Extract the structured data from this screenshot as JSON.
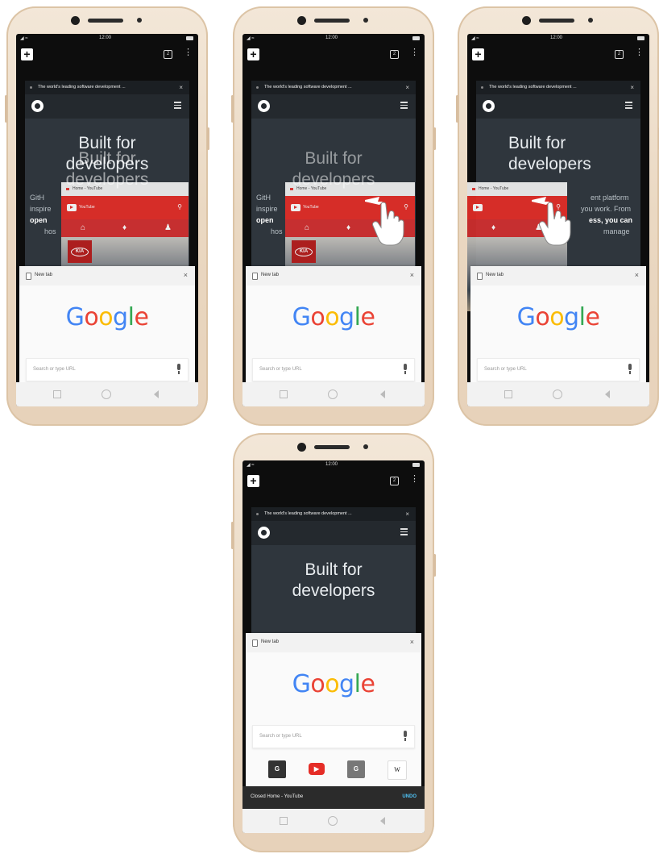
{
  "status": {
    "time": "12:00",
    "signal": "◢ ≈"
  },
  "toolbar": {
    "new_tab_glyph": "+",
    "tab_count": "2",
    "menu_glyph": "⋮"
  },
  "github_tab": {
    "title": "The world's leading software development ...",
    "hero_line1": "Built for",
    "hero_line2": "developers",
    "blurb_fragments": {
      "gith": "GitH",
      "inspi": "inspire",
      "open": "open",
      "hos": "hos",
      "ent_platform": "ent platform",
      "you_work": "you work. From",
      "ess": "ess, you can",
      "manage": "manage"
    }
  },
  "youtube_tab": {
    "title": "Home - YouTube",
    "brand": "YouTube"
  },
  "new_tab": {
    "title": "New tab",
    "logo_letters": [
      {
        "ch": "G",
        "color": "#4285F4"
      },
      {
        "ch": "o",
        "color": "#EA4335"
      },
      {
        "ch": "o",
        "color": "#FBBC05"
      },
      {
        "ch": "g",
        "color": "#4285F4"
      },
      {
        "ch": "l",
        "color": "#34A853"
      },
      {
        "ch": "e",
        "color": "#EA4335"
      }
    ],
    "search_placeholder": "Search or type URL",
    "shortcuts": [
      {
        "label": "G",
        "color": "#333333"
      },
      {
        "label": "▶",
        "color": "#E52D27"
      },
      {
        "label": "G",
        "color": "#777777"
      },
      {
        "label": "W",
        "color": "#ffffff"
      }
    ]
  },
  "snackbar": {
    "message": "Closed Home - YouTube",
    "action": "UNDO"
  },
  "close_glyph": "×"
}
